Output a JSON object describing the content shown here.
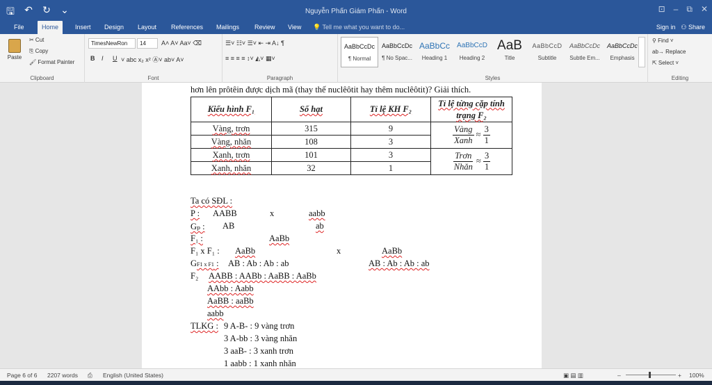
{
  "window": {
    "title": "Nguyễn Phấn Giám Phấn - Word",
    "qa_icons": [
      "save-icon",
      "undo-icon",
      "redo-icon",
      "customize-icon"
    ],
    "qa_glyphs": [
      "🖫",
      "↶",
      "↻",
      "⌄"
    ],
    "controls": [
      "⊡",
      "–",
      "⧉",
      "✕"
    ]
  },
  "tabs": {
    "items": [
      "File",
      "Home",
      "Insert",
      "Design",
      "Layout",
      "References",
      "Mailings",
      "Review",
      "View"
    ],
    "active": "Home",
    "tell_me": "💡 Tell me what you want to do...",
    "sign_in": "Sign in",
    "share": "⚇ Share"
  },
  "ribbon": {
    "clipboard": {
      "label": "Clipboard",
      "paste": "Paste",
      "cut": "✂ Cut",
      "copy": "⎘ Copy",
      "format_painter": "🖌 Format Painter"
    },
    "font": {
      "label": "Font",
      "font_name": "TimesNewRon",
      "font_size": "14",
      "row1_glyphs": "A˄  A˅   Aa˅   ⌫",
      "bold": "B",
      "italic": "I",
      "underline": "U",
      "row2_glyphs": "˅  abc  x₂  x²   Ⓐ˅  ab˅  A˅"
    },
    "paragraph": {
      "label": "Paragraph",
      "row1_glyphs": "☰˅  ☷˅  ☰˅   ⇤  ⇥   A↓   ¶",
      "row2_glyphs": "≡  ≡  ≡  ≡   ↕˅   ◭˅  ▦˅"
    },
    "styles": {
      "label": "Styles",
      "items": [
        {
          "preview": "AaBbCcDc",
          "name": "¶ Normal"
        },
        {
          "preview": "AaBbCcDc",
          "name": "¶ No Spac..."
        },
        {
          "preview": "AaBbCc",
          "name": "Heading 1"
        },
        {
          "preview": "AaBbCcD",
          "name": "Heading 2"
        },
        {
          "preview": "AaB",
          "name": "Title"
        },
        {
          "preview": "AaBbCcD",
          "name": "Subtitle"
        },
        {
          "preview": "AaBbCcDc",
          "name": "Subtle Em..."
        },
        {
          "preview": "AaBbCcDc",
          "name": "Emphasis"
        }
      ]
    },
    "editing": {
      "label": "Editing",
      "find": "⚲ Find ˅",
      "replace": "ab→ Replace",
      "select": "⇱ Select ˅"
    }
  },
  "document": {
    "top_line": "hơn lên prôtêin được dịch mã (thay thế nuclêôtit hay thêm nuclêôtit)? Giải thích.",
    "table": {
      "headers": [
        "Kiểu hình F₁",
        "Số hạt",
        "Tỉ lệ KH F₂",
        "Tỉ lệ từng cặp tính trạng F₂"
      ],
      "rows": [
        [
          "Vàng, trơn",
          "315",
          "9"
        ],
        [
          "Vàng, nhăn",
          "108",
          "3"
        ],
        [
          "Xanh, trơn",
          "101",
          "3"
        ],
        [
          "Xanh, nhăn",
          "32",
          "1"
        ]
      ],
      "ratio1": {
        "num": "Vàng",
        "den": "Xanh",
        "approx": "≈",
        "rnum": "3",
        "rden": "1"
      },
      "ratio2": {
        "num": "Trơn",
        "den": "Nhăn",
        "approx": "≈",
        "rnum": "3",
        "rden": "1"
      }
    },
    "lines": {
      "sdl": "Ta có SĐL :",
      "p_label": "P :",
      "p_left": "AABB",
      "p_x": "x",
      "p_right": "aabb",
      "gp_label": "Gₚ :",
      "gp_left": "AB",
      "gp_right": "ab",
      "f1_label": "F₁ :",
      "f1_val": "AaBb",
      "f1xf1_label": "F₁ x F₁ :",
      "f1xf1_left": "AaBb",
      "f1xf1_x": "x",
      "f1xf1_right": "AaBb",
      "g_label": "G",
      "g_sub": "F1 x F1",
      "g_colon": " :",
      "g_left": "AB : Ab : Ab : ab",
      "g_right": "AB : Ab : Ab : ab",
      "f2_label": "F₂",
      "f2_row1": "AABB : AABb : AaBB : AaBb",
      "f2_row2": "AAbb : Aabb",
      "f2_row3": "AaBB : aaBb",
      "f2_row4": "aabb",
      "tlkg_label": "TLKG :",
      "tlkg_1": "9 A-B- : 9 vàng trơn",
      "tlkg_2": "3 A-bb : 3 vàng nhăn",
      "tlkg_3": "3 aaB- : 3 xanh trơn",
      "tlkg_4": "1 aabb : 1 xanh nhăn"
    }
  },
  "status": {
    "page": "Page 6 of 6",
    "words": "2207 words",
    "proof_icon": "⎙",
    "language": "English (United States)",
    "view_icons": "▣   ▤   ▥",
    "zoom_minus": "–",
    "zoom_plus": "+",
    "zoom": "100%"
  }
}
